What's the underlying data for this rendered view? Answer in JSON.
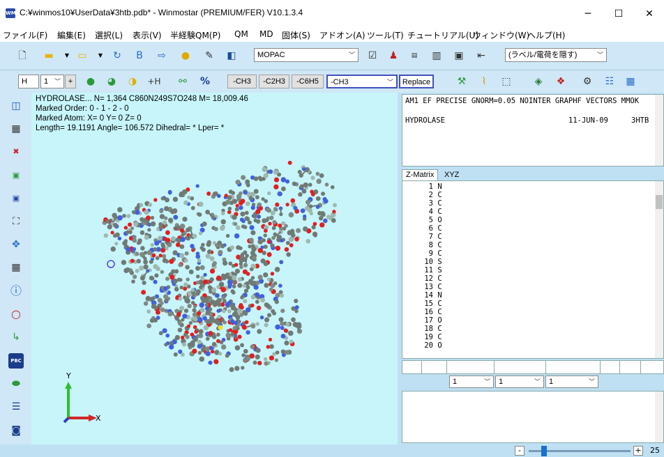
{
  "window": {
    "title": "C:¥winmos10¥UserData¥3htb.pdb* - Winmostar (PREMIUM/FER) V10.1.3.4",
    "app_icon": "WM",
    "minimize": "─",
    "maximize": "☐",
    "close": "✕"
  },
  "menu": [
    "ファイル(F)",
    "編集(E)",
    "選択(L)",
    "表示(V)",
    "半経験QM(P)",
    "QM",
    "MD",
    "固体(S)",
    "アドオン(A)",
    "ツール(T)",
    "チュートリアル(U)",
    "ウィンドウ(W)",
    "ヘルプ(H)"
  ],
  "toolbar1": {
    "method_combo": "MOPAC",
    "label_combo": "(ラベル/電荷を隠す)"
  },
  "toolbar2": {
    "element_combo": "H",
    "valence_combo": "1",
    "add_button": "+",
    "add_h_icon_label": "+H",
    "percent_icon_label": "%",
    "ch3_button": "-CH3",
    "c2h3_button": "-C2H3",
    "c6h5_button": "-C6H5",
    "substituent_combo": "-CH3",
    "replace_button": "Replace"
  },
  "viewport": {
    "line1": "HYDROLASE...  N= 1,364  C860N249S7O248  M= 18,009.46",
    "line2": "Marked Order: 0 - 1 - 2 - 0",
    "line3": "Marked Atom: X= 0 Y= 0 Z= 0",
    "line4": "Length= 19.1191 Angle= 106.572 Dihedral= * Lper= *",
    "axis_y": "Y",
    "axis_x": "X"
  },
  "keywords_pane": {
    "line1": "AM1 EF PRECISE GNORM=0.05 NOINTER GRAPHF VECTORS MMOK",
    "title": "HYDROLASE",
    "date": "11-JUN-09",
    "code": "3HTB"
  },
  "tabs": [
    "Z-Matrix",
    "XYZ"
  ],
  "atoms": [
    {
      "n": "1",
      "el": "N"
    },
    {
      "n": "2",
      "el": "C"
    },
    {
      "n": "3",
      "el": "C"
    },
    {
      "n": "4",
      "el": "C"
    },
    {
      "n": "5",
      "el": "O"
    },
    {
      "n": "6",
      "el": "C"
    },
    {
      "n": "7",
      "el": "C"
    },
    {
      "n": "8",
      "el": "C"
    },
    {
      "n": "9",
      "el": "C"
    },
    {
      "n": "10",
      "el": "S"
    },
    {
      "n": "11",
      "el": "S"
    },
    {
      "n": "12",
      "el": "C"
    },
    {
      "n": "13",
      "el": "C"
    },
    {
      "n": "14",
      "el": "N"
    },
    {
      "n": "15",
      "el": "C"
    },
    {
      "n": "16",
      "el": "C"
    },
    {
      "n": "17",
      "el": "O"
    },
    {
      "n": "18",
      "el": "C"
    },
    {
      "n": "19",
      "el": "C"
    },
    {
      "n": "20",
      "el": "O"
    }
  ],
  "selectors": [
    "1",
    "1",
    "1"
  ],
  "status": {
    "zoom_minus": "-",
    "zoom_plus": "+",
    "zoom_value": "25",
    "zoom_fraction": 0.12
  },
  "left_tools": [
    "view-icon",
    "grid-icon",
    "red-delete-icon",
    "green-icon",
    "blue-icon",
    "fit-icon",
    "center-icon",
    "table-icon",
    "info-icon",
    "circle-icon",
    "axis-icon",
    "pbc-icon",
    "capsule-icon",
    "lines-icon",
    "camera-icon"
  ],
  "left_tool_labels": {
    "pbc": "PBC"
  }
}
